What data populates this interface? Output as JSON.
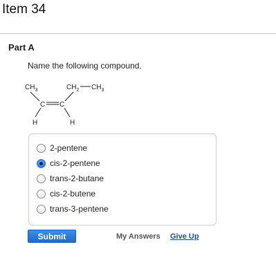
{
  "item": {
    "title": "Item 34"
  },
  "part": {
    "title": "Part A"
  },
  "question": {
    "prompt": "Name the following compound."
  },
  "structure": {
    "top_left": "CH",
    "top_left_sub": "3",
    "top_right_ch": "CH",
    "top_right_ch_sub": "2",
    "top_right_end": "CH",
    "top_right_end_sub": "3",
    "left_carbon": "C",
    "right_carbon": "C",
    "bottom_left": "H",
    "bottom_right": "H"
  },
  "choices": [
    {
      "label": "2-pentene",
      "selected": false
    },
    {
      "label": "cis-2-pentene",
      "selected": true
    },
    {
      "label": "trans-2-butane",
      "selected": false
    },
    {
      "label": "cis-2-butene",
      "selected": false
    },
    {
      "label": "trans-3-pentene",
      "selected": false
    }
  ],
  "actions": {
    "submit_label": "Submit",
    "my_answers_label": "My Answers",
    "give_up_label": "Give Up"
  },
  "colors": {
    "submit_bg": "#1d6cc7",
    "link": "#1a4fa0",
    "radio_selected": "#2f79e8"
  }
}
